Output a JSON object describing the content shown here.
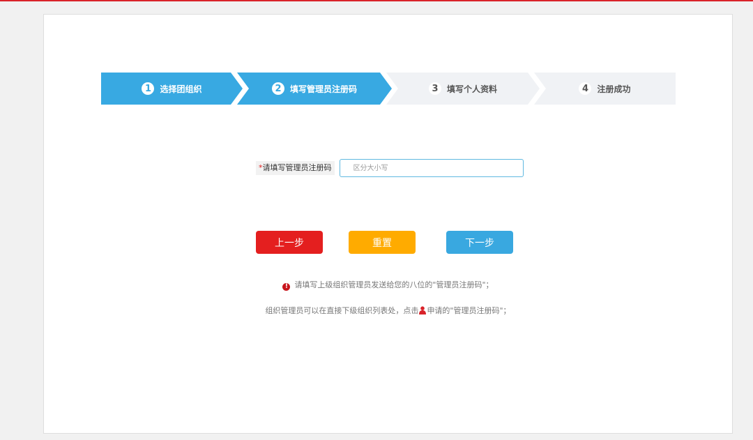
{
  "steps": [
    {
      "number": "1",
      "label": "选择团组织"
    },
    {
      "number": "2",
      "label": "填写管理员注册码"
    },
    {
      "number": "3",
      "label": "填写个人资料"
    },
    {
      "number": "4",
      "label": "注册成功"
    }
  ],
  "form": {
    "required_mark": "*",
    "label": "请填写管理员注册码",
    "value": "",
    "placeholder": "区分大小写"
  },
  "buttons": {
    "prev": "上一步",
    "reset": "重置",
    "next": "下一步"
  },
  "notices": {
    "line1_icon": "!",
    "line1": "请填写上级组织管理员发送给您的八位的\"管理员注册码\"；",
    "line2_before": "组织管理员可以在直接下级组织列表处，点击",
    "line2_after": "申请的\"管理员注册码\"；",
    "line2_icon": "user-icon"
  },
  "colors": {
    "top_line": "#d9232a",
    "step_active": "#38a9e2",
    "step_inactive": "#f0f2f5",
    "prev_button": "#e41f1f",
    "reset_button": "#ffab00",
    "next_button": "#39a8e0",
    "warning_icon": "#c8161d"
  }
}
